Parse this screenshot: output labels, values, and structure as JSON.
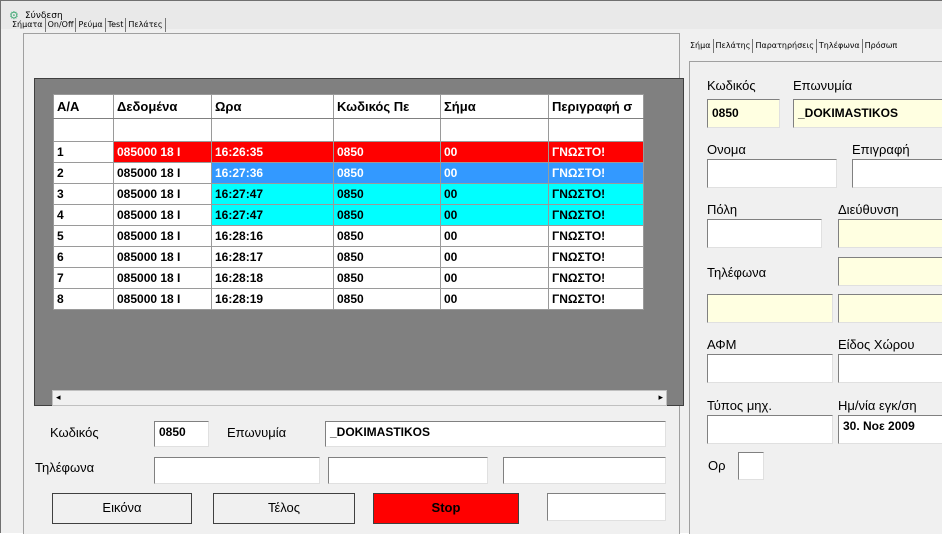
{
  "window": {
    "title": "Σύνδεση"
  },
  "left_tabs": [
    "Σήματα",
    "On/Off",
    "Ρεύμα",
    "Test",
    "Πελάτες"
  ],
  "right_tabs": [
    "Σήμα",
    "Πελάτης",
    "Παρατηρήσεις",
    "Τηλέφωνα",
    "Πρόσωπ"
  ],
  "grid": {
    "columns": [
      "Α/Α",
      "Δεδομένα",
      "Ωρα",
      "Κωδικός Πε",
      "Σήμα",
      "Περιγραφή σ"
    ],
    "rows": [
      {
        "n": "1",
        "data": "085000 18 I",
        "time": "16:26:35",
        "code": "0850",
        "signal": "00",
        "desc": "ΓΝΩΣΤΟ!"
      },
      {
        "n": "2",
        "data": "085000 18 I",
        "time": "16:27:36",
        "code": "0850",
        "signal": "00",
        "desc": "ΓΝΩΣΤΟ!"
      },
      {
        "n": "3",
        "data": "085000 18 I",
        "time": "16:27:47",
        "code": "0850",
        "signal": "00",
        "desc": "ΓΝΩΣΤΟ!"
      },
      {
        "n": "4",
        "data": "085000 18 I",
        "time": "16:27:47",
        "code": "0850",
        "signal": "00",
        "desc": "ΓΝΩΣΤΟ!"
      },
      {
        "n": "5",
        "data": "085000 18 I",
        "time": "16:28:16",
        "code": "0850",
        "signal": "00",
        "desc": "ΓΝΩΣΤΟ!"
      },
      {
        "n": "6",
        "data": "085000 18 I",
        "time": "16:28:17",
        "code": "0850",
        "signal": "00",
        "desc": "ΓΝΩΣΤΟ!"
      },
      {
        "n": "7",
        "data": "085000 18 I",
        "time": "16:28:18",
        "code": "0850",
        "signal": "00",
        "desc": "ΓΝΩΣΤΟ!"
      },
      {
        "n": "8",
        "data": "085000 18 I",
        "time": "16:28:19",
        "code": "0850",
        "signal": "00",
        "desc": "ΓΝΩΣΤΟ!"
      }
    ],
    "colors": {
      "red": "#ff0000",
      "blue": "#3399ff",
      "cyan": "#00ffff",
      "white": "#ffffff",
      "text_light": "#ffffff"
    }
  },
  "bottom": {
    "code_label": "Κωδικός",
    "code_value": "0850",
    "name_label": "Επωνυμία",
    "name_value": "_DOKIMASTIKOS",
    "phones_label": "Τηλέφωνα",
    "phone1": "",
    "phone2": "",
    "phone3": "",
    "extra": ""
  },
  "buttons": {
    "image": "Εικόνα",
    "end": "Τέλος",
    "stop": "Stop"
  },
  "right": {
    "code_label": "Κωδικός",
    "code_value": "0850",
    "name_label": "Επωνυμία",
    "name_value": "_DOKIMASTIKOS",
    "first_name_label": "Ονομα",
    "title_label": "Επιγραφή",
    "city_label": "Πόλη",
    "address_label": "Διεύθυνση",
    "phones_label": "Τηλέφωνα",
    "afm_label": "ΑΦΜ",
    "space_type_label": "Είδος Χώρου",
    "machine_type_label": "Τύπος μηχ.",
    "install_date_label": "Ημ/νία εγκ/ση",
    "install_date_value": "30. Νοε 2009",
    "floor_label": "Ορ"
  }
}
